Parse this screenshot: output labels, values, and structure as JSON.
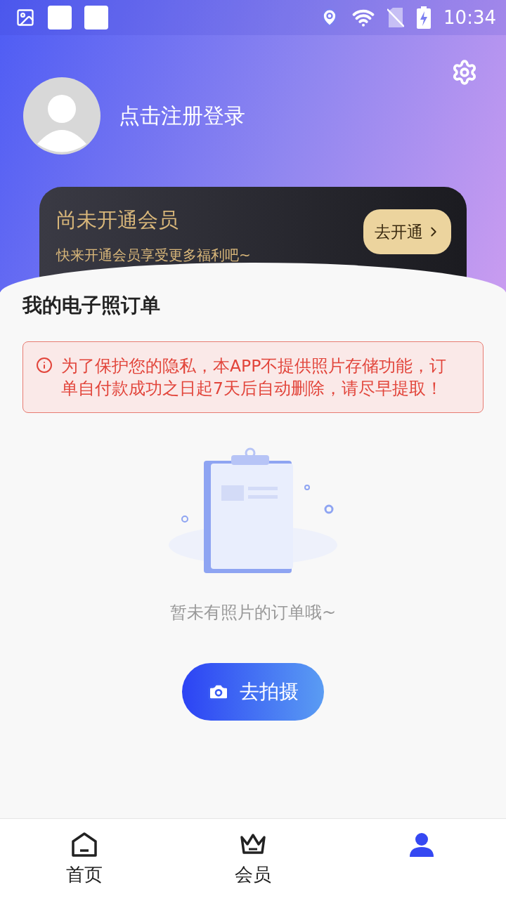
{
  "status_bar": {
    "time": "10:34"
  },
  "profile": {
    "login_prompt": "点击注册登录"
  },
  "membership_card": {
    "title": "尚未开通会员",
    "subtitle": "快来开通会员享受更多福利吧~",
    "button": "去开通"
  },
  "orders": {
    "title": "我的电子照订单",
    "notice": "为了保护您的隐私，本APP不提供照片存储功能，订单自付款成功之日起7天后自动删除，请尽早提取！",
    "empty_text": "暂未有照片的订单哦~",
    "shoot_button": "去拍摄"
  },
  "tab_bar": [
    {
      "kind": "home",
      "label": "首页",
      "selected": false
    },
    {
      "kind": "vip",
      "label": "会员",
      "selected": false
    },
    {
      "kind": "profile",
      "selected": true
    }
  ]
}
